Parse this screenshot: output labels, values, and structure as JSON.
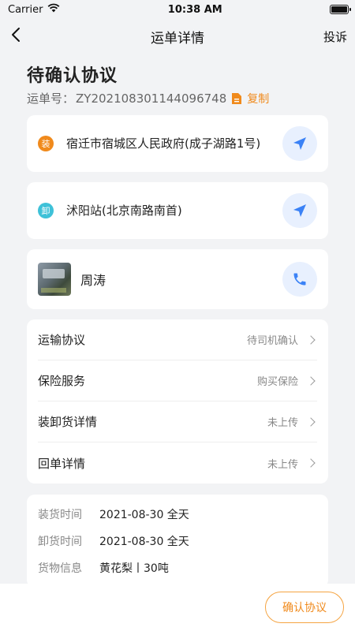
{
  "status_bar": {
    "carrier": "Carrier",
    "time": "10:38 AM",
    "battery_level": 1.0
  },
  "nav": {
    "title": "运单详情",
    "right_action": "投诉"
  },
  "header": {
    "status": "待确认协议",
    "order_label": "运单号：",
    "order_no": "ZY202108301144096748",
    "copy_label": "复制"
  },
  "loading": {
    "badge": "装",
    "badge_color": "#f08a1c",
    "address": "宿迁市宿城区人民政府(成子湖路1号)"
  },
  "unloading": {
    "badge": "卸",
    "badge_color": "#3ec1d8",
    "address": "沭阳站(北京南路南首)"
  },
  "driver": {
    "name": "周涛"
  },
  "menu": [
    {
      "label": "运输协议",
      "value": "待司机确认"
    },
    {
      "label": "保险服务",
      "value": "购买保险"
    },
    {
      "label": "装卸货详情",
      "value": "未上传"
    },
    {
      "label": "回单详情",
      "value": "未上传"
    }
  ],
  "info": [
    {
      "label": "装货时间",
      "value": "2021-08-30 全天"
    },
    {
      "label": "卸货时间",
      "value": "2021-08-30 全天"
    },
    {
      "label": "货物信息",
      "value": "黄花梨丨30吨"
    }
  ],
  "footer": {
    "confirm_label": "确认协议"
  },
  "colors": {
    "accent": "#f08a1c",
    "nav_icon": "#3b82f6"
  },
  "icons": {
    "back": "chevron-left-icon",
    "navigate": "navigation-arrow-icon",
    "phone": "phone-icon",
    "copy": "document-icon",
    "wifi": "wifi-icon"
  }
}
